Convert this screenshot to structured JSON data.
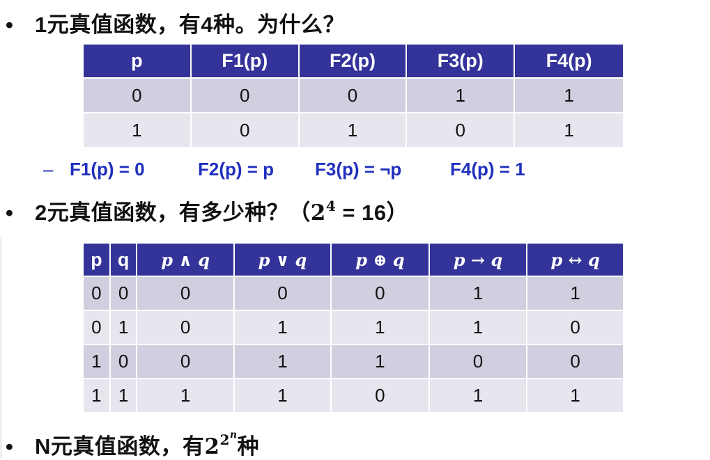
{
  "line1": {
    "bullet": "•",
    "text": "1元真值函数，有4种。为什么？"
  },
  "table1": {
    "headers": [
      "p",
      "F1(p)",
      "F2(p)",
      "F3(p)",
      "F4(p)"
    ],
    "rows": [
      [
        "0",
        "0",
        "0",
        "1",
        "1"
      ],
      [
        "1",
        "0",
        "1",
        "0",
        "1"
      ]
    ]
  },
  "definitions": {
    "dash": "–",
    "items": [
      "F1(p) = 0",
      "F2(p) = p",
      "F3(p) = ¬p",
      "F4(p) = 1"
    ]
  },
  "line2": {
    "bullet": "•",
    "text": "2元真值函数，有多少种？（",
    "base": "2",
    "exp": "4",
    "tail": " = 16）"
  },
  "table2": {
    "headers": [
      "p",
      "q",
      "p ∧ q",
      "p ∨ q",
      "p ⊕ q",
      "p → q",
      "p ↔ q"
    ],
    "rows": [
      [
        "0",
        "0",
        "0",
        "0",
        "0",
        "1",
        "1"
      ],
      [
        "0",
        "1",
        "0",
        "1",
        "1",
        "1",
        "0"
      ],
      [
        "1",
        "0",
        "0",
        "1",
        "1",
        "0",
        "0"
      ],
      [
        "1",
        "1",
        "1",
        "1",
        "0",
        "1",
        "1"
      ]
    ]
  },
  "line3": {
    "bullet": "•",
    "text": "N元真值函数，有",
    "base": "2",
    "exp_base": "2",
    "exp_exp": "n",
    "tail": "种"
  },
  "colors": {
    "header_bg": "#333399",
    "row_dark": "#cfcfdf",
    "row_light": "#e6e6ee",
    "sub_text": "#1f2fbf"
  }
}
